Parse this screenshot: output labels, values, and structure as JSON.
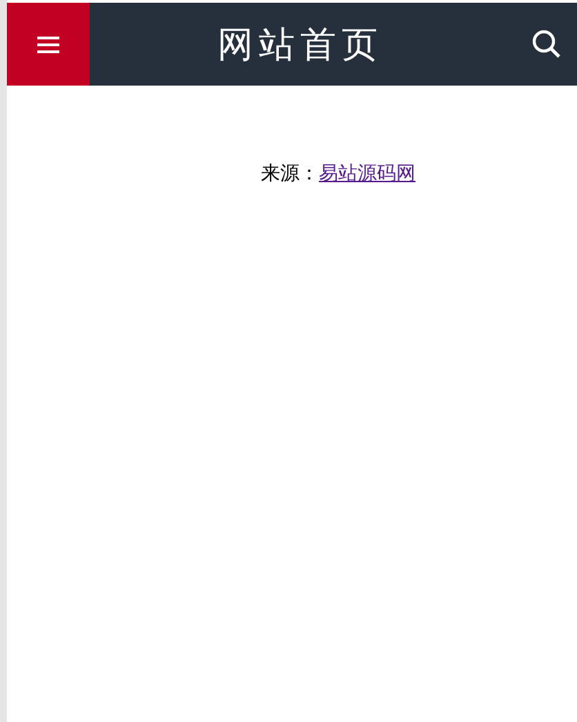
{
  "header": {
    "title": "网站首页"
  },
  "source": {
    "label": "来源：",
    "link": "易站源码网"
  }
}
